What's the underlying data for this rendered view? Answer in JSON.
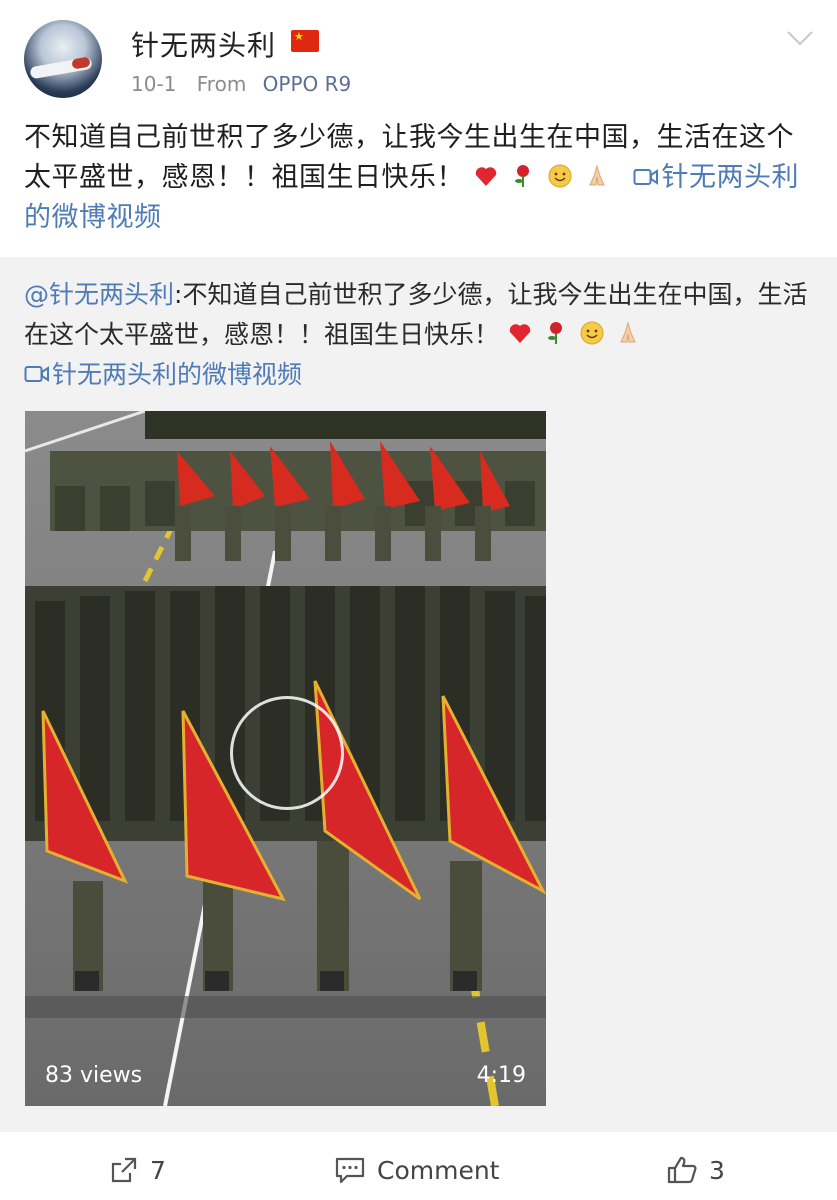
{
  "header": {
    "username": "针无两头利",
    "flag_icon": "china-flag-icon",
    "time": "10-1",
    "from_label": "From",
    "device": "OPPO R9"
  },
  "post": {
    "text": "不知道自己前世积了多少德，让我今生出生在中国，生活在这个太平盛世，感恩！！祖国生日快乐！",
    "emojis": [
      "heart-icon",
      "rose-icon",
      "smile-icon",
      "pray-icon"
    ],
    "video_link": "针无两头利的微博视频"
  },
  "repost": {
    "mention": "@针无两头利",
    "text": ":不知道自己前世积了多少德，让我今生出生在中国，生活在这个太平盛世，感恩！！祖国生日快乐！",
    "video_link": "针无两头利的微博视频"
  },
  "video": {
    "views": "83 views",
    "duration": "4:19"
  },
  "actions": {
    "share_count": "7",
    "comment_label": "Comment",
    "like_count": "3"
  },
  "colors": {
    "link": "#4f7cb6",
    "repost_bg": "#f2f2f2",
    "flag_red": "#de2910"
  }
}
